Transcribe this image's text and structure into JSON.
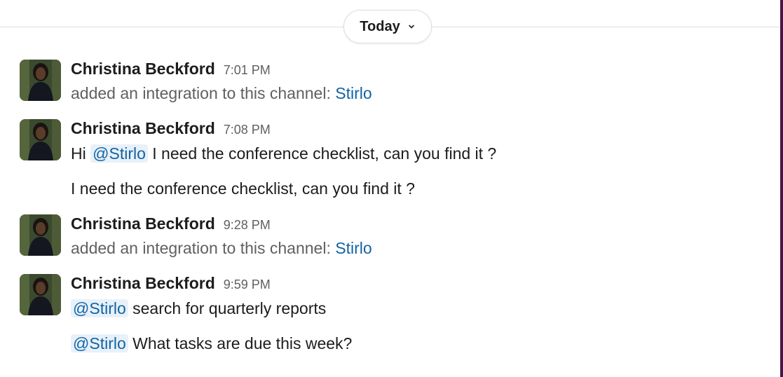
{
  "divider": {
    "label": "Today",
    "chevron_icon": "chevron-down-icon"
  },
  "colors": {
    "link": "#1264a3",
    "mention_bg": "#e8f1f9",
    "sidebar_accent": "#4a154b",
    "muted_text": "#616061"
  },
  "messages": [
    {
      "author": "Christina Beckford",
      "time": "7:01 PM",
      "lines": [
        {
          "text": "added an integration to this channel: ",
          "link": "Stirlo"
        }
      ]
    },
    {
      "author": "Christina Beckford",
      "time": "7:08 PM",
      "lines": [
        {
          "before": "Hi ",
          "mention": "@Stirlo",
          "after": "  I need the conference checklist, can you find it ?"
        },
        {
          "text": "I need the conference checklist, can you find it ?"
        }
      ]
    },
    {
      "author": "Christina Beckford",
      "time": "9:28 PM",
      "lines": [
        {
          "text": "added an integration to this channel: ",
          "link": "Stirlo"
        }
      ]
    },
    {
      "author": "Christina Beckford",
      "time": "9:59 PM",
      "lines": [
        {
          "mention": "@Stirlo",
          "after": " search for quarterly reports"
        },
        {
          "mention": "@Stirlo",
          "after": " What tasks are due this week?"
        }
      ]
    }
  ]
}
